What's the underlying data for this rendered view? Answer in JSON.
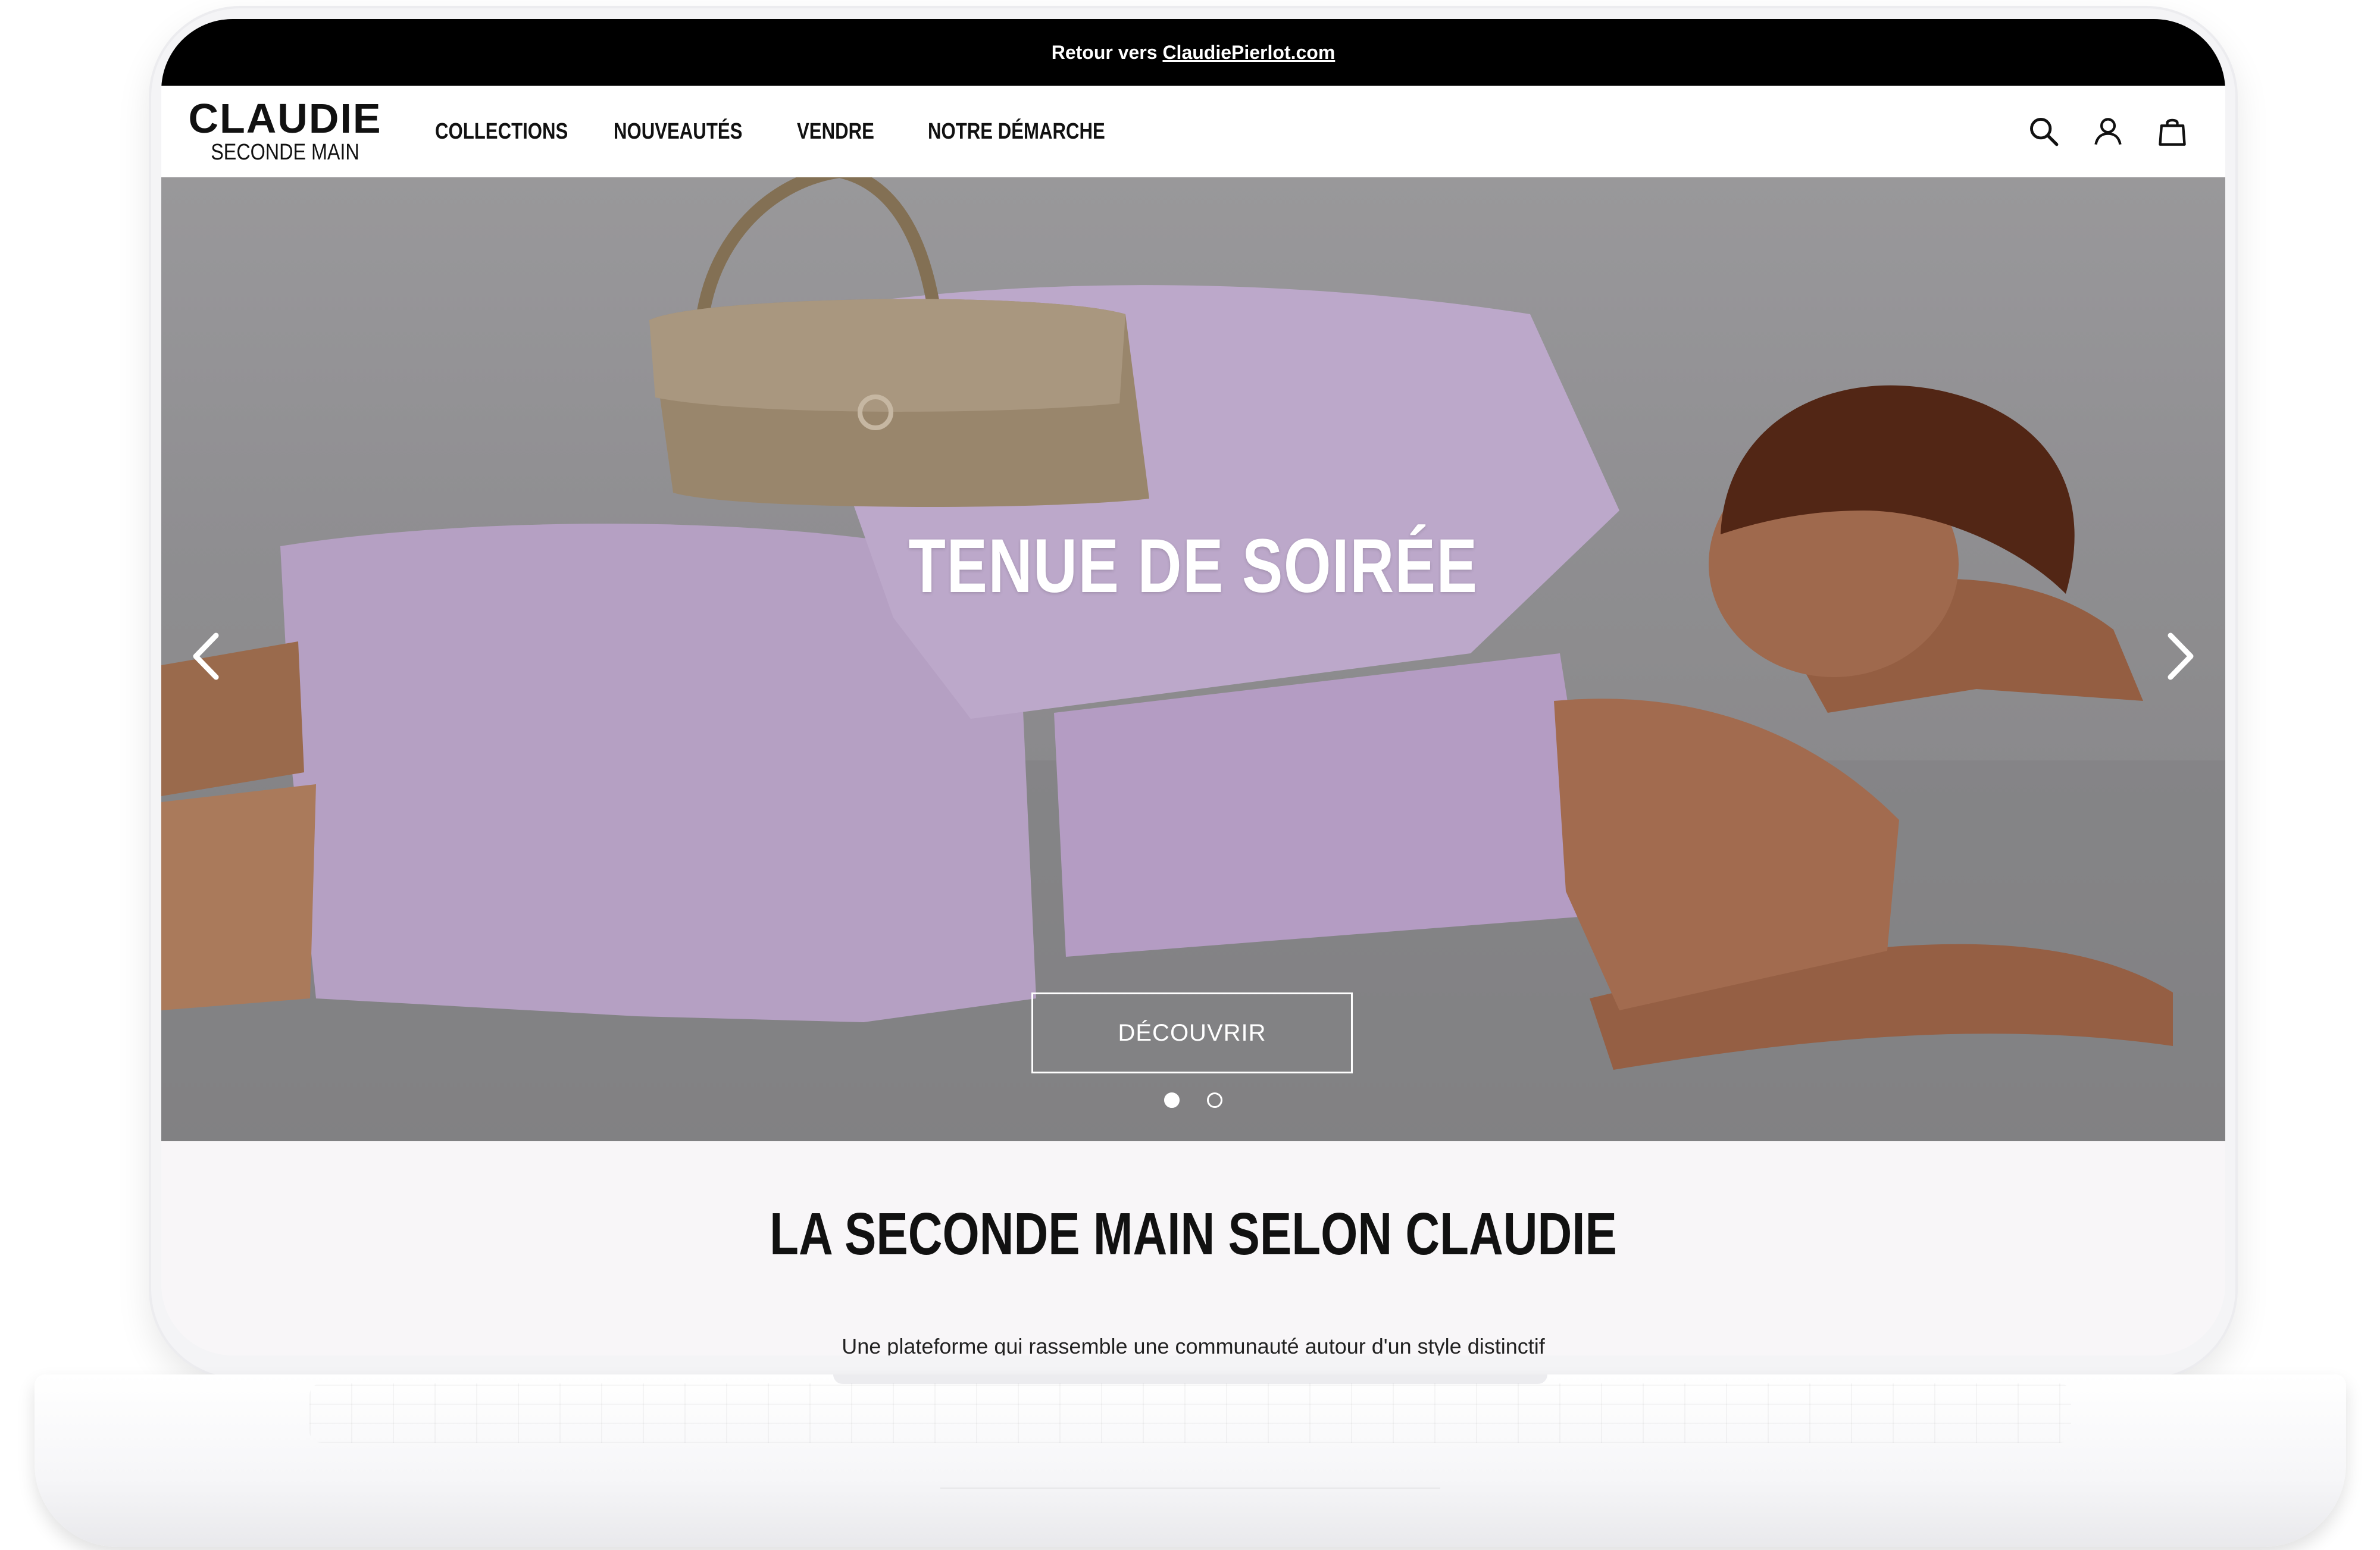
{
  "announcement": {
    "prefix": "Retour vers",
    "link": "ClaudiePierlot.com"
  },
  "header": {
    "logo_top": "CLAUDIE",
    "logo_bottom": "SECONDE MAIN",
    "nav": [
      "COLLECTIONS",
      "NOUVEAUTÉS",
      "VENDRE",
      "NOTRE DÉMARCHE"
    ],
    "icons": [
      "search-icon",
      "account-icon",
      "bag-icon"
    ]
  },
  "hero": {
    "title": "TENUE DE SOIRÉE",
    "cta": "DÉCOUVRIR",
    "slide_count": 2,
    "active_slide": 1
  },
  "intro": {
    "title": "LA SECONDE MAIN SELON CLAUDIE",
    "subtitle": "Une plateforme qui rassemble une communauté autour d'un style distinctif"
  },
  "colors": {
    "topbar": "#000000",
    "hero_bg": "#9a999c",
    "outfit_lilac": "#c7aed6",
    "bag": "#a08c70"
  }
}
